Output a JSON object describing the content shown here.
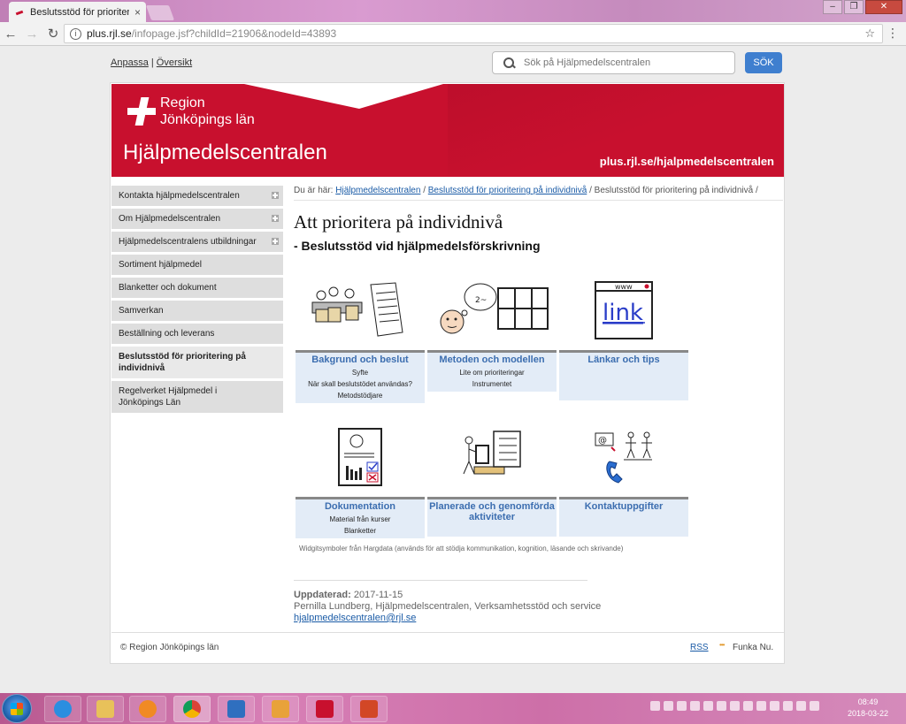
{
  "browser": {
    "tab_title": "Beslutsstöd för prioriteri",
    "tab_close": "×",
    "url_host": "plus.rjl.se",
    "url_path": "/infopage.jsf?childId=21906&nodeId=43893",
    "back": "←",
    "forward": "→",
    "reload": "↻",
    "info": "i",
    "star": "☆",
    "menu": "⋮",
    "win_min": "–",
    "win_max": "❐",
    "win_close": "✕"
  },
  "toplinks": {
    "customize": "Anpassa",
    "separator": "|",
    "overview": "Översikt"
  },
  "search": {
    "placeholder": "Sök på Hjälpmedelscentralen",
    "button": "SÖK"
  },
  "banner": {
    "logo_line1": "Region",
    "logo_line2": "Jönköpings län",
    "title": "Hjälpmedelscentralen",
    "url": "plus.rjl.se/hjalpmedelscentralen",
    "color": "#c8102e"
  },
  "sidebar": {
    "items": [
      {
        "label": "Kontakta hjälpmedelscentralen",
        "expandable": true
      },
      {
        "label": "Om Hjälpmedelscentralen",
        "expandable": true
      },
      {
        "label": "Hjälpmedelscentralens utbildningar",
        "expandable": true
      },
      {
        "label": "Sortiment hjälpmedel",
        "expandable": false
      },
      {
        "label": "Blanketter och dokument",
        "expandable": false
      },
      {
        "label": "Samverkan",
        "expandable": false
      },
      {
        "label": "Beställning och leverans",
        "expandable": false
      },
      {
        "label": "Beslutsstöd för prioritering på individnivå",
        "expandable": false,
        "active": true
      },
      {
        "label": "Regelverket Hjälpmedel i Jönköpings Län",
        "expandable": false
      }
    ]
  },
  "breadcrumb": {
    "prefix": "Du är här:",
    "link1": "Hjälpmedelscentralen",
    "sep": "/",
    "link2": "Beslutsstöd för prioritering på individnivå",
    "current": "Beslutsstöd för prioritering på individnivå"
  },
  "main": {
    "title": "Att prioritera på individnivå",
    "subtitle": "- Beslutsstöd vid hjälpmedelsförskrivning",
    "link_icon_text": "link",
    "www_text": "www",
    "cards": [
      {
        "title": "Bakgrund och beslut",
        "lines": [
          "Syfte",
          "När skall beslutstödet användas?",
          "Metodstödjare"
        ],
        "icon": "meeting-document-icon"
      },
      {
        "title": "Metoden och modellen",
        "lines": [
          "Lite om prioriteringar",
          "Instrumentet"
        ],
        "icon": "thinking-grid-icon"
      },
      {
        "title": "Länkar och tips",
        "lines": [],
        "icon": "www-link-icon"
      },
      {
        "title": "Dokumentation",
        "lines": [
          "Material från kurser",
          "Blanketter"
        ],
        "icon": "document-chart-icon"
      },
      {
        "title": "Planerade och genomförda aktiviteter",
        "lines": [],
        "icon": "planning-list-icon"
      },
      {
        "title": "Kontaktuppgifter",
        "lines": [],
        "icon": "contact-icon"
      }
    ],
    "credit": "Widgitsymboler från Hargdata (används för att stödja kommunikation, kognition, läsande och skrivande)"
  },
  "updated": {
    "label": "Uppdaterad:",
    "date": "2017-11-15",
    "author": "Pernilla Lundberg, Hjälpmedelscentralen, Verksamhetsstöd och service",
    "email": "hjalpmedelscentralen@rjl.se"
  },
  "footer": {
    "copyright": "© Region Jönköpings län",
    "rss": "RSS",
    "funka": "Funka Nu."
  },
  "taskbar": {
    "time": "08:49",
    "date": "2018-03-22"
  }
}
